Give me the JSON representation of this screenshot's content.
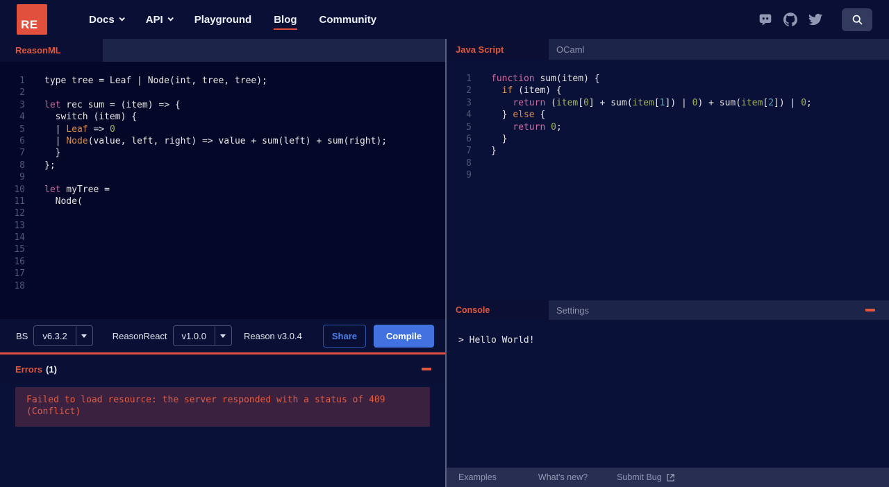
{
  "navbar": {
    "logo_text": "RE",
    "items": [
      {
        "label": "Docs",
        "has_chevron": true,
        "active": false
      },
      {
        "label": "API",
        "has_chevron": true,
        "active": false
      },
      {
        "label": "Playground",
        "has_chevron": false,
        "active": false
      },
      {
        "label": "Blog",
        "has_chevron": false,
        "active": true
      },
      {
        "label": "Community",
        "has_chevron": false,
        "active": false
      }
    ],
    "social_icons": [
      "discord-icon",
      "github-icon",
      "twitter-icon"
    ],
    "search_icon": "magnifier"
  },
  "left_panel": {
    "tab_label": "ReasonML",
    "editor": {
      "language": "reason",
      "lines": [
        {
          "n": "1",
          "t": [
            [
              "p",
              "type tree = Leaf | Node(int, tree, tree);"
            ]
          ]
        },
        {
          "n": "2",
          "t": []
        },
        {
          "n": "3",
          "t": [
            [
              "kw",
              "let"
            ],
            [
              "p",
              " rec sum = (item) => {"
            ]
          ]
        },
        {
          "n": "4",
          "t": [
            [
              "p",
              "  switch (item) {"
            ]
          ]
        },
        {
          "n": "5",
          "t": [
            [
              "p",
              "  | "
            ],
            [
              "or",
              "Leaf"
            ],
            [
              "p",
              " => "
            ],
            [
              "gr",
              "0"
            ]
          ]
        },
        {
          "n": "6",
          "t": [
            [
              "p",
              "  | "
            ],
            [
              "or",
              "Node"
            ],
            [
              "p",
              "(value, left, right) => value + sum(left) + sum(right);"
            ]
          ]
        },
        {
          "n": "7",
          "t": [
            [
              "p",
              "  }"
            ]
          ]
        },
        {
          "n": "8",
          "t": [
            [
              "p",
              "};"
            ]
          ]
        },
        {
          "n": "9",
          "t": []
        },
        {
          "n": "10",
          "t": [
            [
              "kw",
              "let"
            ],
            [
              "p",
              " myTree ="
            ]
          ]
        },
        {
          "n": "11",
          "t": [
            [
              "p",
              "  Node("
            ]
          ]
        },
        {
          "n": "12",
          "t": []
        },
        {
          "n": "13",
          "t": []
        },
        {
          "n": "14",
          "t": []
        },
        {
          "n": "15",
          "t": []
        },
        {
          "n": "16",
          "t": []
        },
        {
          "n": "17",
          "t": []
        },
        {
          "n": "18",
          "t": []
        }
      ]
    },
    "toolbar": {
      "bs_label": "BS",
      "bs_version": "v6.3.2",
      "reasonreact_label": "ReasonReact",
      "reasonreact_version": "v1.0.0",
      "reason_version_text": "Reason v3.0.4",
      "share_label": "Share",
      "compile_label": "Compile"
    },
    "errors": {
      "title": "Errors",
      "count": "(1)",
      "message": "Failed to load resource: the server responded with a status of 409 (Conflict)"
    }
  },
  "right_panel": {
    "tabs": {
      "active": "Java Script",
      "inactive": "OCaml"
    },
    "editor": {
      "language": "javascript",
      "lines": [
        {
          "n": "1",
          "t": [
            [
              "kw",
              "function"
            ],
            [
              "p",
              " sum(item) {"
            ]
          ]
        },
        {
          "n": "2",
          "t": [
            [
              "p",
              "  "
            ],
            [
              "or",
              "if"
            ],
            [
              "p",
              " (item) {"
            ]
          ]
        },
        {
          "n": "3",
          "t": [
            [
              "p",
              "    "
            ],
            [
              "kw",
              "return"
            ],
            [
              "p",
              " ("
            ],
            [
              "gr",
              "item"
            ],
            [
              "p",
              "["
            ],
            [
              "gr",
              "0"
            ],
            [
              "p",
              "] + sum("
            ],
            [
              "gr",
              "item"
            ],
            [
              "p",
              "["
            ],
            [
              "cy",
              "1"
            ],
            [
              "p",
              "]) | "
            ],
            [
              "gr",
              "0"
            ],
            [
              "p",
              ") + sum("
            ],
            [
              "gr",
              "item"
            ],
            [
              "p",
              "["
            ],
            [
              "cy",
              "2"
            ],
            [
              "p",
              "]) | "
            ],
            [
              "gr",
              "0"
            ],
            [
              "p",
              ";"
            ]
          ]
        },
        {
          "n": "4",
          "t": [
            [
              "p",
              "  } "
            ],
            [
              "or",
              "else"
            ],
            [
              "p",
              " {"
            ]
          ]
        },
        {
          "n": "5",
          "t": [
            [
              "p",
              "    "
            ],
            [
              "kw",
              "return"
            ],
            [
              "p",
              " "
            ],
            [
              "gr",
              "0"
            ],
            [
              "p",
              ";"
            ]
          ]
        },
        {
          "n": "6",
          "t": [
            [
              "p",
              "  }"
            ]
          ]
        },
        {
          "n": "7",
          "t": [
            [
              "p",
              "}"
            ]
          ]
        },
        {
          "n": "8",
          "t": []
        },
        {
          "n": "9",
          "t": []
        }
      ]
    },
    "console": {
      "active_tab": "Console",
      "inactive_tab": "Settings",
      "output": "> Hello World!"
    },
    "footer": {
      "examples": "Examples",
      "whats_new": "What's new?",
      "submit_bug": "Submit Bug"
    }
  },
  "colors": {
    "accent_orange": "#e0503c",
    "compile_blue": "#4272e0",
    "share_blue": "#4d7fe8",
    "page_bg": "#0a1035",
    "left_editor_bg": "#040727",
    "right_editor_bg": "#0a1138",
    "tabbar_bg": "#1d2449",
    "error_card_bg": "#3b2140",
    "error_text": "#e65c41",
    "keyword_pink": "#cf6a9e",
    "keyword_orange": "#da8c50",
    "number_green": "#a2b161",
    "number_cyan": "#67a9b7"
  }
}
